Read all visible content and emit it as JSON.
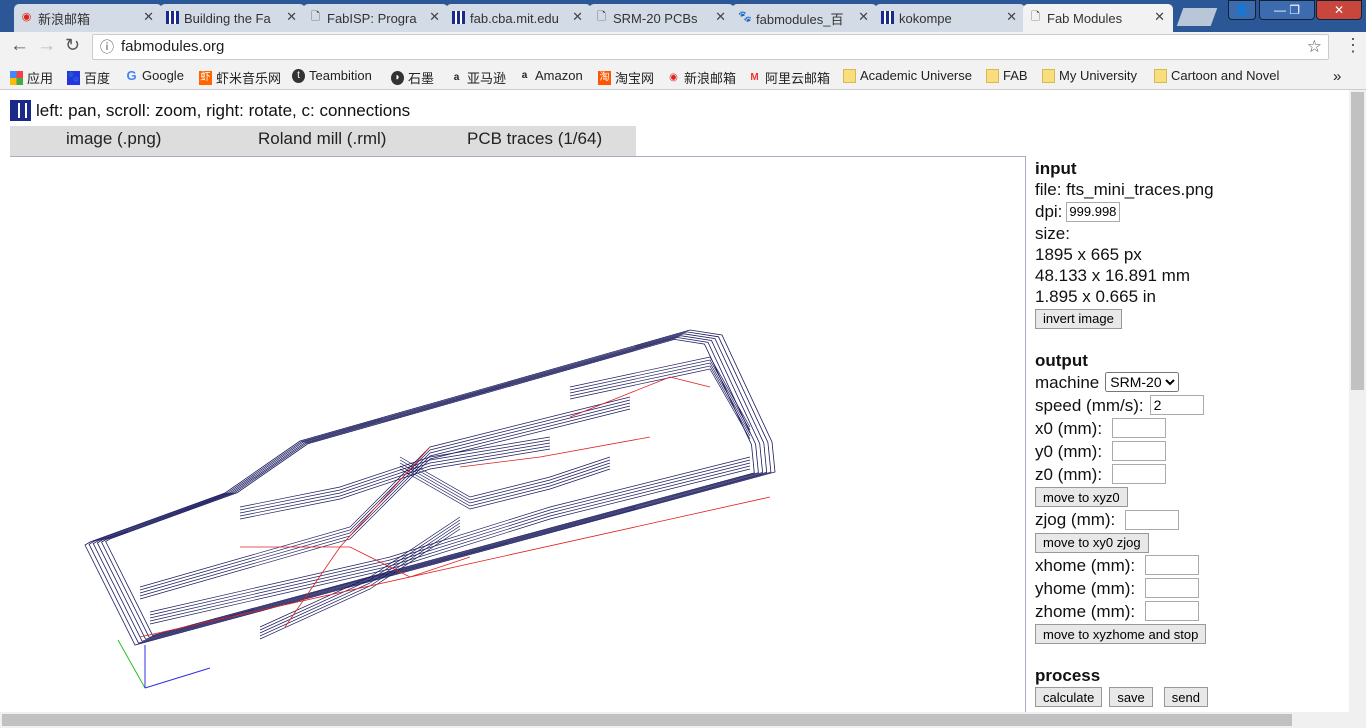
{
  "browser": {
    "tabs": [
      {
        "title": "新浪邮箱",
        "icon": "weibo-icon"
      },
      {
        "title": "Building the Fa",
        "icon": "grid-icon"
      },
      {
        "title": "FabISP: Progra",
        "icon": "page-icon"
      },
      {
        "title": "fab.cba.mit.edu",
        "icon": "grid-icon"
      },
      {
        "title": "SRM-20 PCBs",
        "icon": "page-icon"
      },
      {
        "title": "fabmodules_百",
        "icon": "baidu-paw-icon"
      },
      {
        "title": "kokompe",
        "icon": "grid-icon"
      },
      {
        "title": "Fab Modules",
        "icon": "page-icon",
        "active": true
      }
    ],
    "url": "fabmodules.org",
    "bookmarks": [
      "应用",
      "百度",
      "Google",
      "虾米音乐网",
      "Teambition",
      "石墨",
      "亚马逊",
      "Amazon",
      "淘宝网",
      "新浪邮箱",
      "阿里云邮箱",
      "Academic Universe",
      "FAB",
      "My University",
      "Cartoon and Novel"
    ],
    "more": "»"
  },
  "page": {
    "help": "left: pan, scroll: zoom, right: rotate, c: connections",
    "menu": [
      "image (.png)",
      "Roland mill (.rml)",
      "PCB traces (1/64)"
    ],
    "input": {
      "heading": "input",
      "file": "file: fts_mini_traces.png",
      "dpi_label": "dpi:",
      "dpi": "999.998",
      "size_label": "size:",
      "px": "1895 x 665 px",
      "mm": "48.133 x 16.891 mm",
      "in": "1.895 x 0.665 in",
      "invert": "invert image"
    },
    "output": {
      "heading": "output",
      "machine_label": "machine",
      "machine": "SRM-20",
      "speed_label": "speed (mm/s):",
      "speed": "2",
      "x0": "x0 (mm):",
      "y0": "y0 (mm):",
      "z0": "z0 (mm):",
      "move_xyz0": "move to xyz0",
      "zjog": "zjog (mm):",
      "move_zjog": "move to xy0 zjog",
      "xhome": "xhome (mm):",
      "yhome": "yhome (mm):",
      "zhome": "zhome (mm):",
      "move_home": "move to xyzhome and stop"
    },
    "process": {
      "heading": "process",
      "calculate": "calculate",
      "save": "save",
      "send": "send"
    },
    "colors": {
      "toolpath": "#1a1a5e",
      "connections": "#e02020"
    }
  }
}
